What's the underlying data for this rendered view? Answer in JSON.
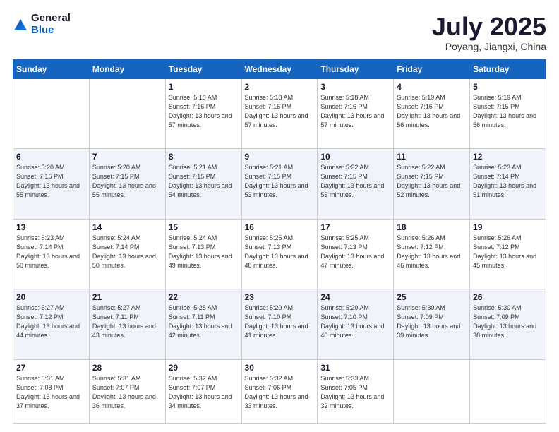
{
  "header": {
    "logo_general": "General",
    "logo_blue": "Blue",
    "month": "July 2025",
    "location": "Poyang, Jiangxi, China"
  },
  "weekdays": [
    "Sunday",
    "Monday",
    "Tuesday",
    "Wednesday",
    "Thursday",
    "Friday",
    "Saturday"
  ],
  "weeks": [
    [
      {
        "day": null
      },
      {
        "day": null
      },
      {
        "day": "1",
        "sunrise": "Sunrise: 5:18 AM",
        "sunset": "Sunset: 7:16 PM",
        "daylight": "Daylight: 13 hours and 57 minutes."
      },
      {
        "day": "2",
        "sunrise": "Sunrise: 5:18 AM",
        "sunset": "Sunset: 7:16 PM",
        "daylight": "Daylight: 13 hours and 57 minutes."
      },
      {
        "day": "3",
        "sunrise": "Sunrise: 5:18 AM",
        "sunset": "Sunset: 7:16 PM",
        "daylight": "Daylight: 13 hours and 57 minutes."
      },
      {
        "day": "4",
        "sunrise": "Sunrise: 5:19 AM",
        "sunset": "Sunset: 7:16 PM",
        "daylight": "Daylight: 13 hours and 56 minutes."
      },
      {
        "day": "5",
        "sunrise": "Sunrise: 5:19 AM",
        "sunset": "Sunset: 7:15 PM",
        "daylight": "Daylight: 13 hours and 56 minutes."
      }
    ],
    [
      {
        "day": "6",
        "sunrise": "Sunrise: 5:20 AM",
        "sunset": "Sunset: 7:15 PM",
        "daylight": "Daylight: 13 hours and 55 minutes."
      },
      {
        "day": "7",
        "sunrise": "Sunrise: 5:20 AM",
        "sunset": "Sunset: 7:15 PM",
        "daylight": "Daylight: 13 hours and 55 minutes."
      },
      {
        "day": "8",
        "sunrise": "Sunrise: 5:21 AM",
        "sunset": "Sunset: 7:15 PM",
        "daylight": "Daylight: 13 hours and 54 minutes."
      },
      {
        "day": "9",
        "sunrise": "Sunrise: 5:21 AM",
        "sunset": "Sunset: 7:15 PM",
        "daylight": "Daylight: 13 hours and 53 minutes."
      },
      {
        "day": "10",
        "sunrise": "Sunrise: 5:22 AM",
        "sunset": "Sunset: 7:15 PM",
        "daylight": "Daylight: 13 hours and 53 minutes."
      },
      {
        "day": "11",
        "sunrise": "Sunrise: 5:22 AM",
        "sunset": "Sunset: 7:15 PM",
        "daylight": "Daylight: 13 hours and 52 minutes."
      },
      {
        "day": "12",
        "sunrise": "Sunrise: 5:23 AM",
        "sunset": "Sunset: 7:14 PM",
        "daylight": "Daylight: 13 hours and 51 minutes."
      }
    ],
    [
      {
        "day": "13",
        "sunrise": "Sunrise: 5:23 AM",
        "sunset": "Sunset: 7:14 PM",
        "daylight": "Daylight: 13 hours and 50 minutes."
      },
      {
        "day": "14",
        "sunrise": "Sunrise: 5:24 AM",
        "sunset": "Sunset: 7:14 PM",
        "daylight": "Daylight: 13 hours and 50 minutes."
      },
      {
        "day": "15",
        "sunrise": "Sunrise: 5:24 AM",
        "sunset": "Sunset: 7:13 PM",
        "daylight": "Daylight: 13 hours and 49 minutes."
      },
      {
        "day": "16",
        "sunrise": "Sunrise: 5:25 AM",
        "sunset": "Sunset: 7:13 PM",
        "daylight": "Daylight: 13 hours and 48 minutes."
      },
      {
        "day": "17",
        "sunrise": "Sunrise: 5:25 AM",
        "sunset": "Sunset: 7:13 PM",
        "daylight": "Daylight: 13 hours and 47 minutes."
      },
      {
        "day": "18",
        "sunrise": "Sunrise: 5:26 AM",
        "sunset": "Sunset: 7:12 PM",
        "daylight": "Daylight: 13 hours and 46 minutes."
      },
      {
        "day": "19",
        "sunrise": "Sunrise: 5:26 AM",
        "sunset": "Sunset: 7:12 PM",
        "daylight": "Daylight: 13 hours and 45 minutes."
      }
    ],
    [
      {
        "day": "20",
        "sunrise": "Sunrise: 5:27 AM",
        "sunset": "Sunset: 7:12 PM",
        "daylight": "Daylight: 13 hours and 44 minutes."
      },
      {
        "day": "21",
        "sunrise": "Sunrise: 5:27 AM",
        "sunset": "Sunset: 7:11 PM",
        "daylight": "Daylight: 13 hours and 43 minutes."
      },
      {
        "day": "22",
        "sunrise": "Sunrise: 5:28 AM",
        "sunset": "Sunset: 7:11 PM",
        "daylight": "Daylight: 13 hours and 42 minutes."
      },
      {
        "day": "23",
        "sunrise": "Sunrise: 5:29 AM",
        "sunset": "Sunset: 7:10 PM",
        "daylight": "Daylight: 13 hours and 41 minutes."
      },
      {
        "day": "24",
        "sunrise": "Sunrise: 5:29 AM",
        "sunset": "Sunset: 7:10 PM",
        "daylight": "Daylight: 13 hours and 40 minutes."
      },
      {
        "day": "25",
        "sunrise": "Sunrise: 5:30 AM",
        "sunset": "Sunset: 7:09 PM",
        "daylight": "Daylight: 13 hours and 39 minutes."
      },
      {
        "day": "26",
        "sunrise": "Sunrise: 5:30 AM",
        "sunset": "Sunset: 7:09 PM",
        "daylight": "Daylight: 13 hours and 38 minutes."
      }
    ],
    [
      {
        "day": "27",
        "sunrise": "Sunrise: 5:31 AM",
        "sunset": "Sunset: 7:08 PM",
        "daylight": "Daylight: 13 hours and 37 minutes."
      },
      {
        "day": "28",
        "sunrise": "Sunrise: 5:31 AM",
        "sunset": "Sunset: 7:07 PM",
        "daylight": "Daylight: 13 hours and 36 minutes."
      },
      {
        "day": "29",
        "sunrise": "Sunrise: 5:32 AM",
        "sunset": "Sunset: 7:07 PM",
        "daylight": "Daylight: 13 hours and 34 minutes."
      },
      {
        "day": "30",
        "sunrise": "Sunrise: 5:32 AM",
        "sunset": "Sunset: 7:06 PM",
        "daylight": "Daylight: 13 hours and 33 minutes."
      },
      {
        "day": "31",
        "sunrise": "Sunrise: 5:33 AM",
        "sunset": "Sunset: 7:05 PM",
        "daylight": "Daylight: 13 hours and 32 minutes."
      },
      {
        "day": null
      },
      {
        "day": null
      }
    ]
  ]
}
